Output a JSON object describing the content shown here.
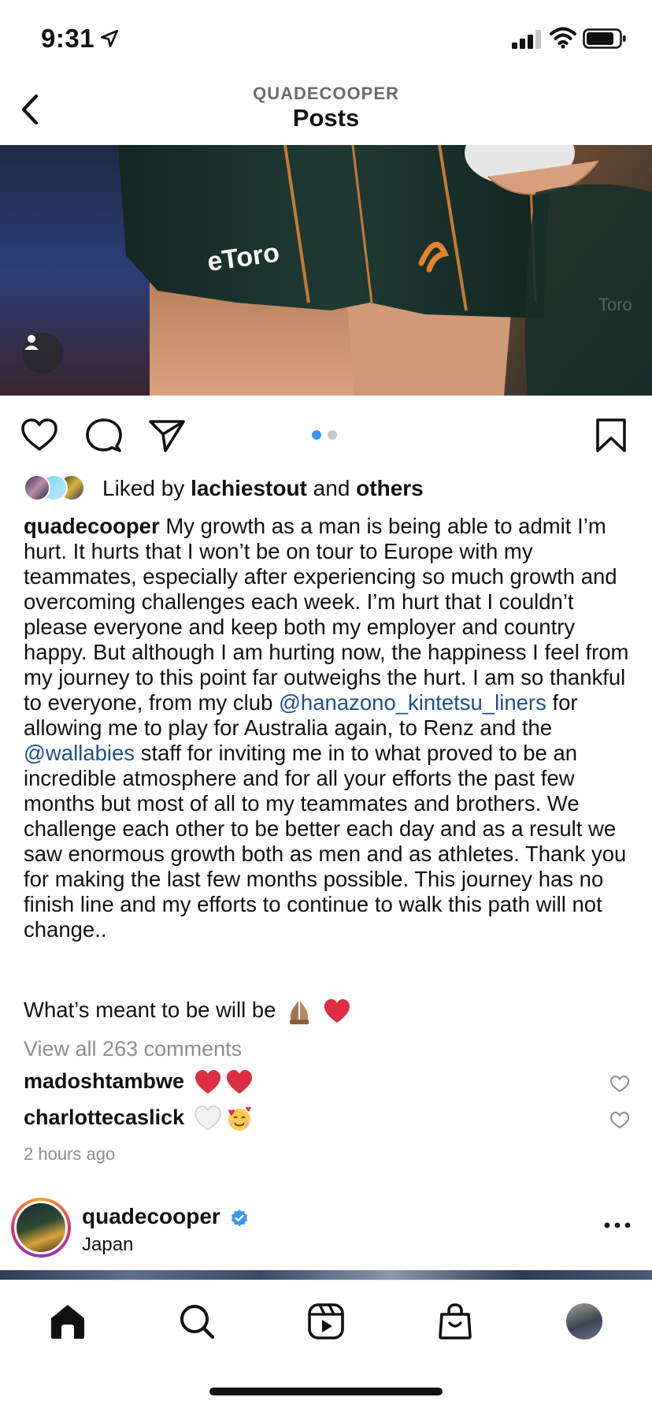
{
  "status_bar": {
    "time": "9:31"
  },
  "header": {
    "username": "QUADECOOPER",
    "title": "Posts"
  },
  "post": {
    "carousel": {
      "count": 2,
      "active": 1,
      "active_color": "#3897f0",
      "inactive_color": "#c7c7c7"
    },
    "likes": {
      "prefix": "Liked by",
      "user": "lachiestout",
      "and": "and",
      "others": "others"
    },
    "caption": {
      "user": "quadecooper",
      "text_1": "My growth as a man is being able to admit I’m hurt. It hurts that I won’t be on tour to Europe with my teammates, especially after experiencing so much growth and overcoming challenges each week. I’m hurt that I couldn’t please everyone and keep both my employer and country happy. But although I am hurting now, the happiness I feel from my journey to this point far outweighs the hurt. I am so thankful to everyone, from my club",
      "mention_1": "@hanazono_kintetsu_liners",
      "text_2": "for allowing me to play for Australia again, to Renz and the",
      "mention_2": "@wallabies",
      "text_3": "staff for inviting me in to what proved to be an incredible atmosphere and for all your efforts the past few months but most of all to my teammates and brothers. We challenge each other to be better each day and as a result we saw enormous growth both as men and as athletes. Thank you for making the last few months possible. This journey has no finish line and my efforts to continue to walk this path will not change..",
      "closing": "What’s meant to be will be"
    },
    "view_comments": "View all 263 comments",
    "comments": [
      {
        "user": "madoshtambwe",
        "emojis": [
          "red-heart",
          "red-heart"
        ]
      },
      {
        "user": "charlottecaslick",
        "emojis": [
          "white-heart",
          "smiling-face-with-hearts"
        ]
      }
    ],
    "timestamp": "2 hours ago"
  },
  "next_post": {
    "user": "quadecooper",
    "location": "Japan",
    "verified": true
  },
  "tab_bar": {
    "tabs": [
      "home-icon",
      "search-icon",
      "reels-icon",
      "shop-icon",
      "profile-avatar"
    ]
  },
  "colors": {
    "link": "#1f4f8b",
    "muted": "#8e8e8e",
    "verified": "#3897f0"
  }
}
